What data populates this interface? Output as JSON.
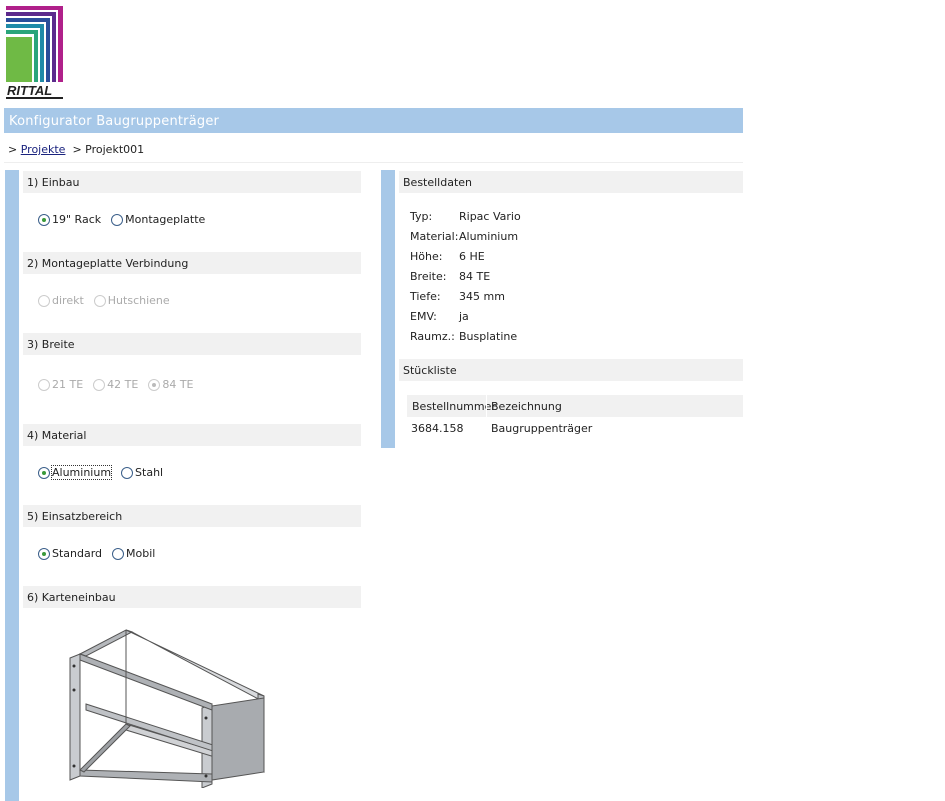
{
  "logo": {
    "text": "RITTAL"
  },
  "header": {
    "title": "Konfigurator Baugruppenträger"
  },
  "breadcrumb": {
    "link": "Projekte",
    "current": "Projekt001"
  },
  "sections": [
    {
      "title": "1) Einbau",
      "options": [
        {
          "label": "19\" Rack",
          "checked": true,
          "disabled": false
        },
        {
          "label": "Montageplatte",
          "checked": false,
          "disabled": false
        }
      ]
    },
    {
      "title": "2) Montageplatte Verbindung",
      "options": [
        {
          "label": "direkt",
          "checked": false,
          "disabled": true
        },
        {
          "label": "Hutschiene",
          "checked": false,
          "disabled": true
        }
      ]
    },
    {
      "title": "3) Breite",
      "options": [
        {
          "label": "21 TE",
          "checked": false,
          "disabled": true
        },
        {
          "label": "42 TE",
          "checked": false,
          "disabled": true
        },
        {
          "label": "84 TE",
          "checked": true,
          "disabled": true
        }
      ]
    },
    {
      "title": "4) Material",
      "options": [
        {
          "label": "Aluminium",
          "checked": true,
          "disabled": false
        },
        {
          "label": "Stahl",
          "checked": false,
          "disabled": false
        }
      ]
    },
    {
      "title": "5) Einsatzbereich",
      "options": [
        {
          "label": "Standard",
          "checked": true,
          "disabled": false
        },
        {
          "label": "Mobil",
          "checked": false,
          "disabled": false
        }
      ]
    },
    {
      "title": "6) Karteneinbau"
    }
  ],
  "order": {
    "title": "Bestelldaten",
    "rows": [
      {
        "k": "Typ:",
        "v": "Ripac Vario"
      },
      {
        "k": "Material:",
        "v": "Aluminium"
      },
      {
        "k": "Höhe:",
        "v": "6 HE"
      },
      {
        "k": "Breite:",
        "v": "84 TE"
      },
      {
        "k": "Tiefe:",
        "v": "345 mm"
      },
      {
        "k": "EMV:",
        "v": "ja"
      },
      {
        "k": "Raumz.:",
        "v": "Busplatine"
      }
    ]
  },
  "parts": {
    "title": "Stückliste",
    "headers": [
      "Bestellnummer",
      "Bezeichnung"
    ],
    "rows": [
      [
        "3684.158",
        "Baugruppenträger"
      ]
    ]
  }
}
